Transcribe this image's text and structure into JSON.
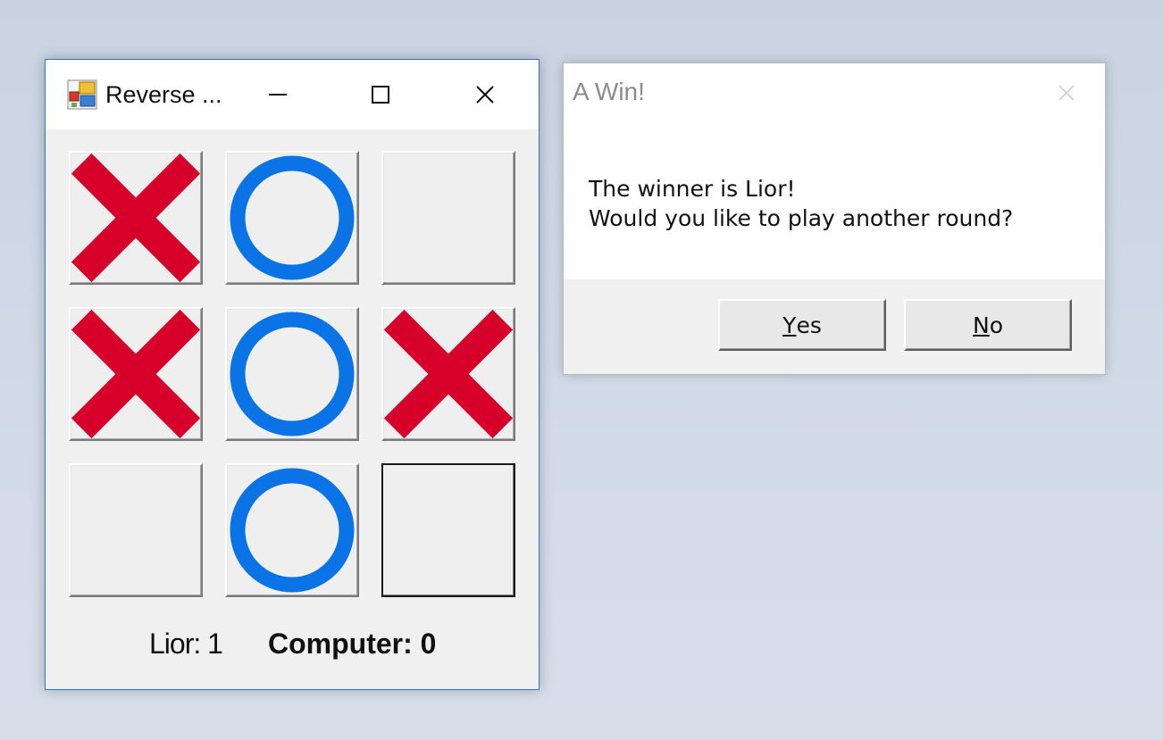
{
  "game_window": {
    "title": "Reverse ...",
    "app_icon": "winforms-app-icon",
    "controls": [
      "minimize-icon",
      "maximize-icon",
      "close-icon"
    ]
  },
  "board": {
    "cells": [
      "X",
      "O",
      "",
      "X",
      "O",
      "X",
      "",
      "O",
      ""
    ],
    "focused_cell": 8,
    "colors": {
      "x": "#d6002a",
      "o": "#0a74e6"
    }
  },
  "score": {
    "lior": "Lior: 1",
    "computer": "Computer: 0"
  },
  "dialog": {
    "title": "A Win!",
    "line1": "The winner is Lior!",
    "line2": "Would you like to play another round?",
    "yes_access": "Y",
    "yes_rest": "es",
    "no_access": "N",
    "no_rest": "o"
  }
}
